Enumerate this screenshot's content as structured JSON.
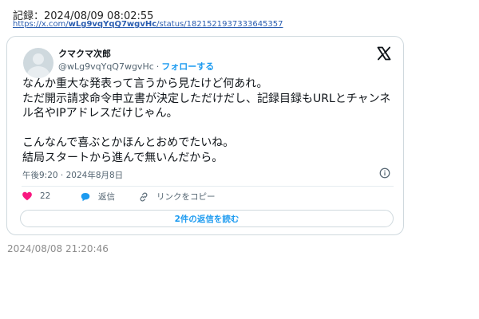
{
  "record": {
    "label": "記録：2024/08/09 08:02:55",
    "url_prefix": "https://x.com/",
    "url_user": "wLg9vqYqQ7wgvHc",
    "url_suffix": "/status/1821521937333645357"
  },
  "tweet": {
    "display_name": "クマクマ次郎",
    "handle": "@wLg9vqYqQ7wgvHc",
    "separator": "·",
    "follow_label": "フォローする",
    "text": "なんか重大な発表って言うから見たけど何あれ。\nただ開示請求命令申立書が決定しただけだし、記録目録もURLとチャンネル名やIPアドレスだけじゃん。\n\nこんなんで喜ぶとかほんとおめでたいね。\n結局スタートから進んで無いんだから。",
    "timestamp": "午後9:20 · 2024年8月8日",
    "like_count": "22",
    "reply_label": "返信",
    "copy_link_label": "リンクをコピー",
    "read_replies_label": "2件の返信を読む"
  },
  "footer": {
    "date": "2024/08/08 21:20:46"
  },
  "colors": {
    "accent": "#1d9bf0",
    "like": "#f91880",
    "muted": "#536471",
    "border": "#cfd9de"
  },
  "icons": [
    "x-logo-icon",
    "info-icon",
    "heart-icon",
    "reply-icon",
    "link-icon",
    "avatar"
  ]
}
